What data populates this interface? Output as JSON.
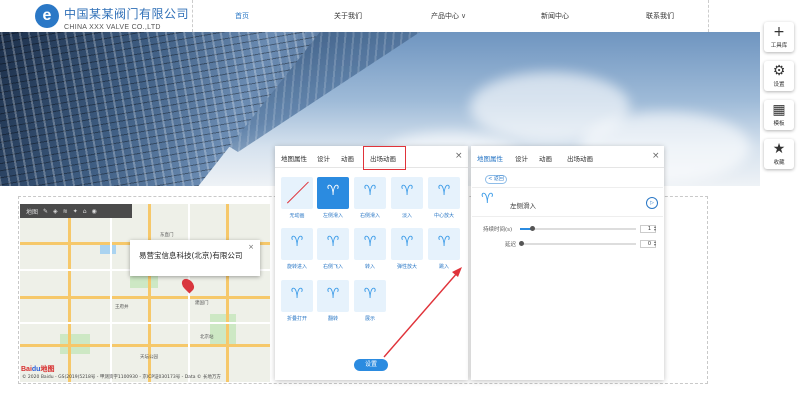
{
  "header": {
    "brand_cn": "中国某某阀门有限公司",
    "brand_en": "CHINA XXX VALVE CO.,LTD",
    "logo_letter": "e",
    "nav": [
      "首页",
      "关于我们",
      "产品中心",
      "新闻中心",
      "联系我们"
    ],
    "dropdown_glyph": "∨"
  },
  "toolbar": [
    {
      "icon": "plus-icon",
      "glyph": "+",
      "label": "工具库"
    },
    {
      "icon": "gear-icon",
      "glyph": "⚙",
      "label": "设置"
    },
    {
      "icon": "template-icon",
      "glyph": "▦",
      "label": "模板"
    },
    {
      "icon": "star-icon",
      "glyph": "★",
      "label": "收藏"
    }
  ],
  "map": {
    "toolbar_label": "地图",
    "popup_text": "易营宝信息科技(北京)有限公司",
    "popup_close": "×",
    "baidu_logo": "Bai",
    "baidu_logo_b": "du",
    "baidu_logo_c": "地图",
    "copyright": "© 2020 Baidu - GS(2019)5218号 - 甲测资字1100930 - 京ICP证030173号 - Data © 长地万方",
    "labels": [
      "东直门",
      "王府井",
      "建国门",
      "天坛公园",
      "北京站"
    ]
  },
  "panel1": {
    "tabs": [
      "地图属性",
      "设计",
      "动画",
      "出场动画"
    ],
    "close": "×",
    "animations": [
      "无动画",
      "左侧滑入",
      "右侧滑入",
      "淡入",
      "中心放大",
      "旋转进入",
      "右侧飞入",
      "转入",
      "弹性放大",
      "跳入",
      "折叠打开",
      "翻转",
      "展示"
    ],
    "button": "设置"
  },
  "panel2": {
    "tabs": [
      "地图属性",
      "设计",
      "动画",
      "出场动画"
    ],
    "close": "×",
    "back": "< 返回",
    "title": "左侧滑入",
    "play": "▷",
    "duration_label": "持续时间(s)",
    "duration_value": "1",
    "delay_label": "延迟",
    "delay_value": "0"
  },
  "colors": {
    "accent": "#2b78c6",
    "highlight": "#e0333a"
  }
}
